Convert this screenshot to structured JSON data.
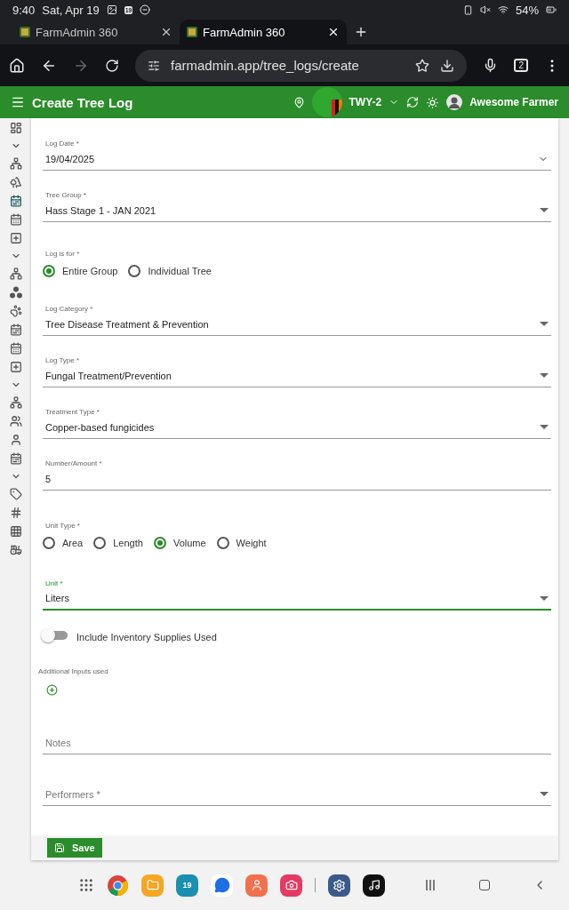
{
  "status_bar": {
    "time": "9:40",
    "date": "Sat, Apr 19",
    "calendar_day": "19",
    "battery": "54%"
  },
  "browser": {
    "tabs": [
      {
        "title": "FarmAdmin 360",
        "selected": false
      },
      {
        "title": "FarmAdmin 360",
        "selected": true
      }
    ],
    "url": "farmadmin.app/tree_logs/create",
    "tab_count": "2"
  },
  "app_bar": {
    "title": "Create Tree Log",
    "farm": "TWY-2",
    "user": "Awesome Farmer"
  },
  "sidebar": {
    "items": [
      {
        "kind": "dashboard",
        "selected": false
      },
      {
        "kind": "chevron",
        "selected": false
      },
      {
        "kind": "hub",
        "selected": false
      },
      {
        "kind": "trees",
        "selected": false
      },
      {
        "kind": "event",
        "selected": true
      },
      {
        "kind": "calendar",
        "selected": false
      },
      {
        "kind": "add",
        "selected": false
      },
      {
        "kind": "chevron",
        "selected": false
      },
      {
        "kind": "hub",
        "selected": false
      },
      {
        "kind": "dots",
        "selected": false
      },
      {
        "kind": "paw",
        "selected": false
      },
      {
        "kind": "event",
        "selected": false
      },
      {
        "kind": "calendar",
        "selected": false
      },
      {
        "kind": "add",
        "selected": false
      },
      {
        "kind": "chevron",
        "selected": false
      },
      {
        "kind": "hub",
        "selected": false
      },
      {
        "kind": "people",
        "selected": false
      },
      {
        "kind": "person",
        "selected": false
      },
      {
        "kind": "event",
        "selected": false
      },
      {
        "kind": "chevron",
        "selected": false
      },
      {
        "kind": "tag",
        "selected": false
      },
      {
        "kind": "hash",
        "selected": false
      },
      {
        "kind": "grid",
        "selected": false
      },
      {
        "kind": "tractor",
        "selected": false
      }
    ]
  },
  "form": {
    "fields": [
      {
        "kind": "date",
        "label": "Log Date *",
        "value": "19/04/2025",
        "focused": false
      },
      {
        "kind": "select",
        "label": "Tree Group *",
        "value": "Hass Stage 1 - JAN 2021",
        "focused": false
      },
      {
        "kind": "radio",
        "label": "Log is for *",
        "options": [
          {
            "label": "Entire Group",
            "selected": true
          },
          {
            "label": "Individual Tree",
            "selected": false
          }
        ]
      },
      {
        "kind": "select",
        "label": "Log Category *",
        "value": "Tree Disease Treatment & Prevention",
        "focused": false
      },
      {
        "kind": "select",
        "label": "Log Type *",
        "value": "Fungal Treatment/Prevention",
        "focused": false
      },
      {
        "kind": "select",
        "label": "Treatment Type *",
        "value": "Copper-based fungicides",
        "focused": false
      },
      {
        "kind": "text",
        "label": "Number/Amount *",
        "value": "5",
        "focused": false
      },
      {
        "kind": "radio",
        "label": "Unit Type *",
        "options": [
          {
            "label": "Area",
            "selected": false
          },
          {
            "label": "Length",
            "selected": false
          },
          {
            "label": "Volume",
            "selected": true
          },
          {
            "label": "Weight",
            "selected": false
          }
        ]
      },
      {
        "kind": "select",
        "label": "Unit *",
        "value": "Liters",
        "focused": true
      },
      {
        "kind": "toggle",
        "label": "Include Inventory Supplies Used",
        "on": false
      },
      {
        "kind": "inputs",
        "label": "Additional Inputs used"
      },
      {
        "kind": "text",
        "placeholder": "Notes",
        "focused": false
      },
      {
        "kind": "select",
        "placeholder": "Performers *",
        "focused": false
      }
    ],
    "save_button": "Save"
  },
  "dock": {
    "apps": [
      {
        "kind": "apps"
      },
      {
        "kind": "chrome"
      },
      {
        "kind": "files"
      },
      {
        "kind": "calendar",
        "label": "19"
      },
      {
        "kind": "messages"
      },
      {
        "kind": "contacts"
      },
      {
        "kind": "camera"
      },
      {
        "kind": "divider"
      },
      {
        "kind": "settings"
      },
      {
        "kind": "tiktok"
      }
    ]
  }
}
